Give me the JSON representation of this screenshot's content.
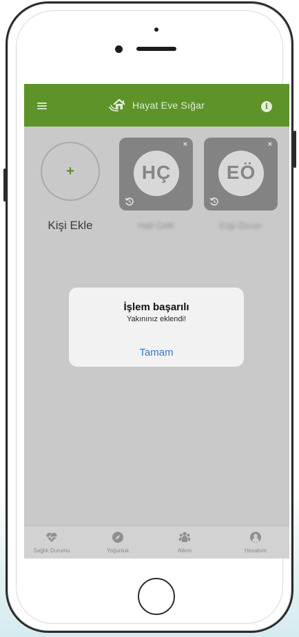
{
  "appbar": {
    "title": "Hayat Eve Sığar",
    "info_label": "i"
  },
  "add_person": {
    "plus": "+",
    "label": "Kişi Ekle"
  },
  "persons": [
    {
      "initials": "HÇ",
      "name": "Halil Çelik",
      "remove": "×"
    },
    {
      "initials": "EÖ",
      "name": "Ezgi Özcan",
      "remove": "×"
    }
  ],
  "dialog": {
    "title": "İşlem başarılı",
    "message": "Yakınınız eklendi!",
    "button": "Tamam"
  },
  "tabs": [
    {
      "label": "Sağlık Durumu",
      "icon": "heart-pulse-icon"
    },
    {
      "label": "Yoğunluk",
      "icon": "compass-icon"
    },
    {
      "label": "Ailem",
      "icon": "users-icon"
    },
    {
      "label": "Hesabım",
      "icon": "user-circle-icon"
    }
  ],
  "colors": {
    "brand_green": "#5e932a",
    "dialog_button": "#2f78c8",
    "overlay_gray": "#c9c9c9"
  }
}
